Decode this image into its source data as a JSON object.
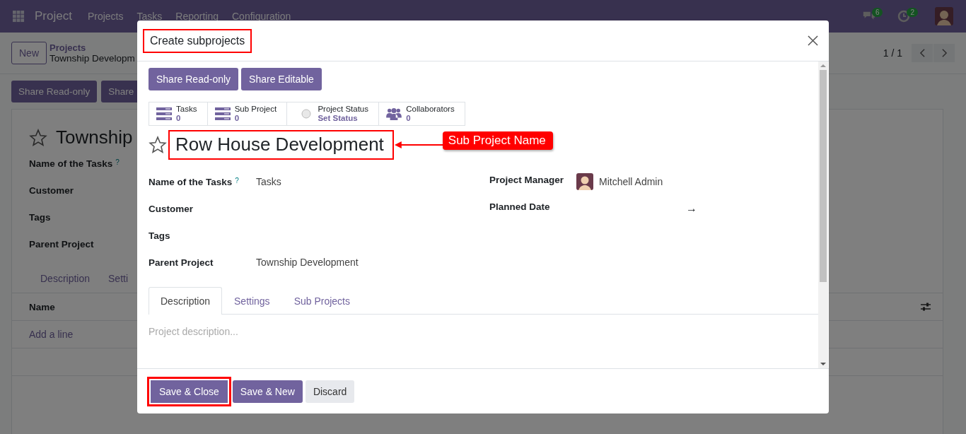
{
  "navbar": {
    "app": "Project",
    "menu": [
      "Projects",
      "Tasks",
      "Reporting",
      "Configuration"
    ],
    "messages_badge": "6",
    "activities_badge": "2"
  },
  "control_panel": {
    "new_button": "New",
    "breadcrumb_parent": "Projects",
    "breadcrumb_current": "Township Developm",
    "pager": "1 / 1"
  },
  "header_buttons": [
    "Share Read-only",
    "Share"
  ],
  "form": {
    "title": "Township",
    "starred": false,
    "fields": [
      {
        "label": "Name of the Tasks",
        "help": "?"
      },
      {
        "label": "Customer"
      },
      {
        "label": "Tags"
      },
      {
        "label": "Parent Project"
      }
    ],
    "tabs": [
      "Description",
      "Setti"
    ],
    "list": {
      "column": "Name",
      "add_line": "Add a line"
    }
  },
  "dialog": {
    "title": {
      "text": "Create subprojects",
      "highlighted": true
    },
    "share_buttons": [
      "Share Read-only",
      "Share Editable"
    ],
    "stats": [
      {
        "kind": "list",
        "label": "Tasks",
        "value": "0"
      },
      {
        "kind": "list",
        "label": "Sub Project",
        "value": "0"
      },
      {
        "kind": "status",
        "label": "Project Status",
        "value": "Set Status"
      },
      {
        "kind": "users",
        "label": "Collaborators",
        "value": "0"
      }
    ],
    "name": {
      "text": "Row House Development",
      "highlighted": true
    },
    "starred": false,
    "annotation": "Sub Project Name",
    "left_fields": [
      {
        "label": "Name of the Tasks",
        "help": "?",
        "value": "Tasks"
      },
      {
        "label": "Customer"
      },
      {
        "label": "Tags"
      },
      {
        "label": "Parent Project",
        "value": "Township Development"
      }
    ],
    "right_fields": [
      {
        "kind": "user",
        "label": "Project Manager",
        "value": "Mitchell Admin"
      },
      {
        "kind": "daterange",
        "label": "Planned Date",
        "separator": "→"
      }
    ],
    "tabs": [
      {
        "label": "Description",
        "selected": true
      },
      {
        "label": "Settings",
        "selected": false
      },
      {
        "label": "Sub Projects",
        "selected": false
      }
    ],
    "description_placeholder": "Project description...",
    "footer_buttons": [
      {
        "kind": "primary",
        "label": "Save & Close",
        "highlighted": true
      },
      {
        "kind": "primary",
        "label": "Save & New",
        "highlighted": false
      },
      {
        "kind": "secondary",
        "label": "Discard",
        "highlighted": false
      }
    ]
  }
}
